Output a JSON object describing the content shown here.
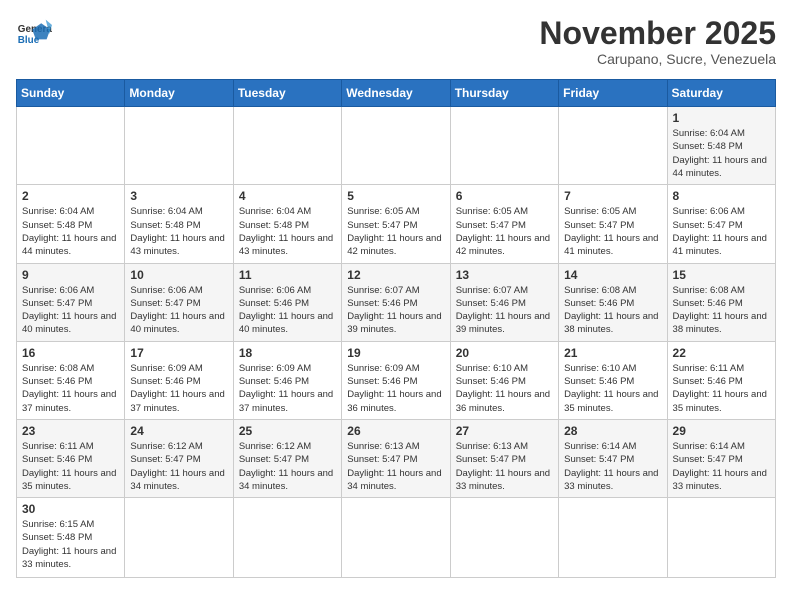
{
  "header": {
    "logo_general": "General",
    "logo_blue": "Blue",
    "month_title": "November 2025",
    "subtitle": "Carupano, Sucre, Venezuela"
  },
  "days_of_week": [
    "Sunday",
    "Monday",
    "Tuesday",
    "Wednesday",
    "Thursday",
    "Friday",
    "Saturday"
  ],
  "weeks": [
    [
      {
        "day": "",
        "info": ""
      },
      {
        "day": "",
        "info": ""
      },
      {
        "day": "",
        "info": ""
      },
      {
        "day": "",
        "info": ""
      },
      {
        "day": "",
        "info": ""
      },
      {
        "day": "",
        "info": ""
      },
      {
        "day": "1",
        "info": "Sunrise: 6:04 AM\nSunset: 5:48 PM\nDaylight: 11 hours and 44 minutes."
      }
    ],
    [
      {
        "day": "2",
        "info": "Sunrise: 6:04 AM\nSunset: 5:48 PM\nDaylight: 11 hours and 44 minutes."
      },
      {
        "day": "3",
        "info": "Sunrise: 6:04 AM\nSunset: 5:48 PM\nDaylight: 11 hours and 43 minutes."
      },
      {
        "day": "4",
        "info": "Sunrise: 6:04 AM\nSunset: 5:48 PM\nDaylight: 11 hours and 43 minutes."
      },
      {
        "day": "5",
        "info": "Sunrise: 6:05 AM\nSunset: 5:47 PM\nDaylight: 11 hours and 42 minutes."
      },
      {
        "day": "6",
        "info": "Sunrise: 6:05 AM\nSunset: 5:47 PM\nDaylight: 11 hours and 42 minutes."
      },
      {
        "day": "7",
        "info": "Sunrise: 6:05 AM\nSunset: 5:47 PM\nDaylight: 11 hours and 41 minutes."
      },
      {
        "day": "8",
        "info": "Sunrise: 6:06 AM\nSunset: 5:47 PM\nDaylight: 11 hours and 41 minutes."
      }
    ],
    [
      {
        "day": "9",
        "info": "Sunrise: 6:06 AM\nSunset: 5:47 PM\nDaylight: 11 hours and 40 minutes."
      },
      {
        "day": "10",
        "info": "Sunrise: 6:06 AM\nSunset: 5:47 PM\nDaylight: 11 hours and 40 minutes."
      },
      {
        "day": "11",
        "info": "Sunrise: 6:06 AM\nSunset: 5:46 PM\nDaylight: 11 hours and 40 minutes."
      },
      {
        "day": "12",
        "info": "Sunrise: 6:07 AM\nSunset: 5:46 PM\nDaylight: 11 hours and 39 minutes."
      },
      {
        "day": "13",
        "info": "Sunrise: 6:07 AM\nSunset: 5:46 PM\nDaylight: 11 hours and 39 minutes."
      },
      {
        "day": "14",
        "info": "Sunrise: 6:08 AM\nSunset: 5:46 PM\nDaylight: 11 hours and 38 minutes."
      },
      {
        "day": "15",
        "info": "Sunrise: 6:08 AM\nSunset: 5:46 PM\nDaylight: 11 hours and 38 minutes."
      }
    ],
    [
      {
        "day": "16",
        "info": "Sunrise: 6:08 AM\nSunset: 5:46 PM\nDaylight: 11 hours and 37 minutes."
      },
      {
        "day": "17",
        "info": "Sunrise: 6:09 AM\nSunset: 5:46 PM\nDaylight: 11 hours and 37 minutes."
      },
      {
        "day": "18",
        "info": "Sunrise: 6:09 AM\nSunset: 5:46 PM\nDaylight: 11 hours and 37 minutes."
      },
      {
        "day": "19",
        "info": "Sunrise: 6:09 AM\nSunset: 5:46 PM\nDaylight: 11 hours and 36 minutes."
      },
      {
        "day": "20",
        "info": "Sunrise: 6:10 AM\nSunset: 5:46 PM\nDaylight: 11 hours and 36 minutes."
      },
      {
        "day": "21",
        "info": "Sunrise: 6:10 AM\nSunset: 5:46 PM\nDaylight: 11 hours and 35 minutes."
      },
      {
        "day": "22",
        "info": "Sunrise: 6:11 AM\nSunset: 5:46 PM\nDaylight: 11 hours and 35 minutes."
      }
    ],
    [
      {
        "day": "23",
        "info": "Sunrise: 6:11 AM\nSunset: 5:46 PM\nDaylight: 11 hours and 35 minutes."
      },
      {
        "day": "24",
        "info": "Sunrise: 6:12 AM\nSunset: 5:47 PM\nDaylight: 11 hours and 34 minutes."
      },
      {
        "day": "25",
        "info": "Sunrise: 6:12 AM\nSunset: 5:47 PM\nDaylight: 11 hours and 34 minutes."
      },
      {
        "day": "26",
        "info": "Sunrise: 6:13 AM\nSunset: 5:47 PM\nDaylight: 11 hours and 34 minutes."
      },
      {
        "day": "27",
        "info": "Sunrise: 6:13 AM\nSunset: 5:47 PM\nDaylight: 11 hours and 33 minutes."
      },
      {
        "day": "28",
        "info": "Sunrise: 6:14 AM\nSunset: 5:47 PM\nDaylight: 11 hours and 33 minutes."
      },
      {
        "day": "29",
        "info": "Sunrise: 6:14 AM\nSunset: 5:47 PM\nDaylight: 11 hours and 33 minutes."
      }
    ],
    [
      {
        "day": "30",
        "info": "Sunrise: 6:15 AM\nSunset: 5:48 PM\nDaylight: 11 hours and 33 minutes."
      },
      {
        "day": "",
        "info": ""
      },
      {
        "day": "",
        "info": ""
      },
      {
        "day": "",
        "info": ""
      },
      {
        "day": "",
        "info": ""
      },
      {
        "day": "",
        "info": ""
      },
      {
        "day": "",
        "info": ""
      }
    ]
  ]
}
